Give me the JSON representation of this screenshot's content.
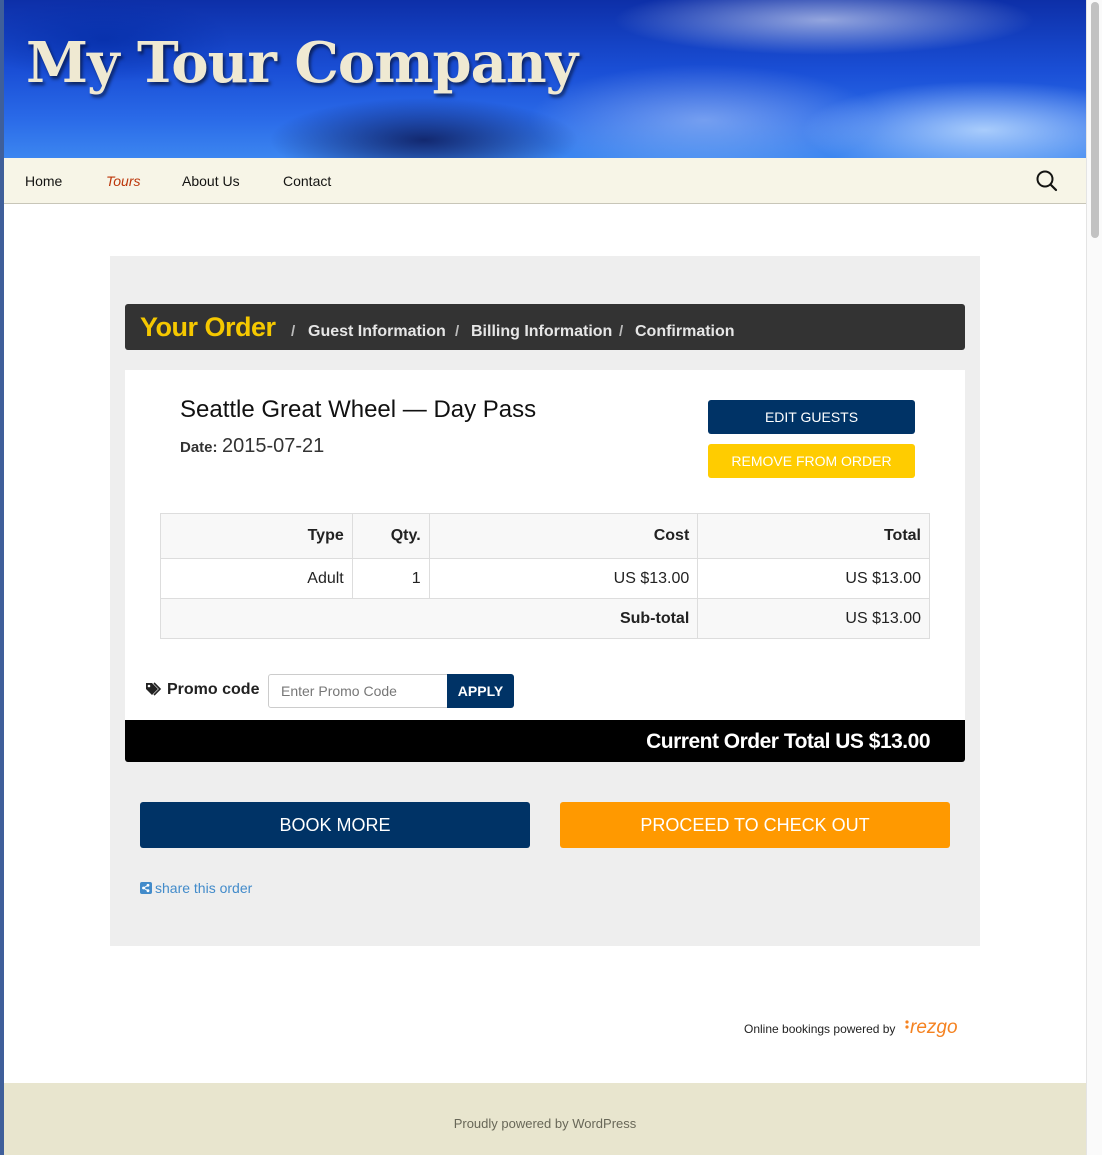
{
  "site": {
    "title": "My Tour Company"
  },
  "nav": {
    "items": [
      {
        "label": "Home",
        "active": false
      },
      {
        "label": "Tours",
        "active": true
      },
      {
        "label": "About Us",
        "active": false
      },
      {
        "label": "Contact",
        "active": false
      }
    ],
    "search_icon": "search-icon"
  },
  "steps": {
    "current": "Your Order",
    "separator": "/",
    "items": [
      "Guest Information",
      "Billing Information",
      "Confirmation"
    ]
  },
  "order": {
    "item_title": "Seattle Great Wheel — Day Pass",
    "date_label": "Date:",
    "date_value": "2015-07-21",
    "edit_label": "EDIT GUESTS",
    "remove_label": "REMOVE FROM ORDER",
    "table": {
      "headers": [
        "Type",
        "Qty.",
        "Cost",
        "Total"
      ],
      "rows": [
        {
          "type": "Adult",
          "qty": "1",
          "cost": "US $13.00",
          "total": "US $13.00"
        }
      ],
      "subtotal_label": "Sub-total",
      "subtotal_value": "US $13.00"
    },
    "promo": {
      "label": "Promo code",
      "placeholder": "Enter Promo Code",
      "value": "",
      "apply_label": "APPLY"
    },
    "total_text": "Current Order Total US $13.00"
  },
  "actions": {
    "book_more": "BOOK MORE",
    "checkout": "PROCEED TO CHECK OUT",
    "share": "share this order"
  },
  "powered_by": {
    "text": "Online bookings powered by",
    "logo": "rezgo"
  },
  "footer": {
    "text": "Proudly powered by WordPress"
  },
  "colors": {
    "navy": "#003366",
    "yellow": "#ffcc00",
    "orange": "#ff9900",
    "step_highlight": "#f5c800",
    "link": "#428bca",
    "nav_active": "#bc360a"
  }
}
